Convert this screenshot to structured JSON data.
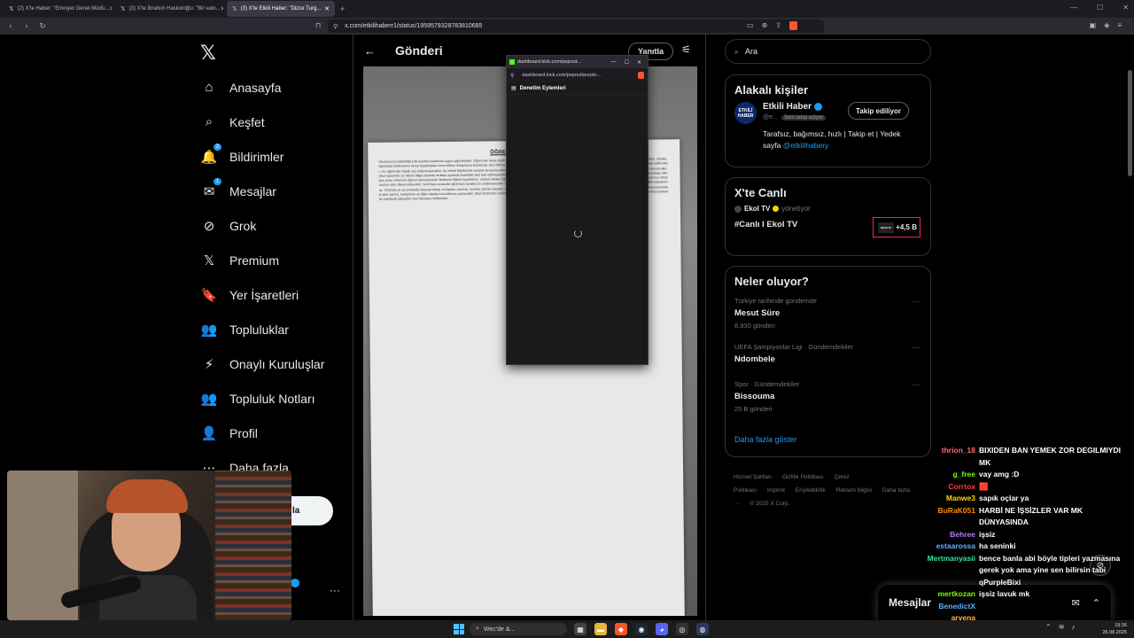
{
  "browser": {
    "tabs": [
      {
        "label": "(2) X'te Haber: \"Emniyet Genel Müdü...",
        "active": false
      },
      {
        "label": "(3) X'te İbrahim Haskoloğlu: \"Bir vatn...",
        "active": false
      },
      {
        "label": "(3) X'te Etkili Haber: \"Dizce Turg...",
        "active": true
      }
    ],
    "url": "x.com/etkilihaberr1/status/1959579328783810685"
  },
  "x": {
    "nav": [
      {
        "label": "Anasayfa",
        "icon": "home-icon",
        "glyph": "⌂",
        "badge": ""
      },
      {
        "label": "Keşfet",
        "icon": "search-icon",
        "glyph": "⌕",
        "badge": ""
      },
      {
        "label": "Bildirimler",
        "icon": "bell-icon",
        "glyph": "🔔",
        "badge": "3"
      },
      {
        "label": "Mesajlar",
        "icon": "mail-icon",
        "glyph": "✉",
        "badge": "1"
      },
      {
        "label": "Grok",
        "icon": "grok-icon",
        "glyph": "⊘",
        "badge": ""
      },
      {
        "label": "Premium",
        "icon": "x-premium-icon",
        "glyph": "𝕏",
        "badge": ""
      },
      {
        "label": "Yer İşaretleri",
        "icon": "bookmark-icon",
        "glyph": "🔖",
        "badge": ""
      },
      {
        "label": "Topluluklar",
        "icon": "communities-icon",
        "glyph": "👥",
        "badge": ""
      },
      {
        "label": "Onaylı Kuruluşlar",
        "icon": "lightning-icon",
        "glyph": "⚡",
        "badge": ""
      },
      {
        "label": "Topluluk Notları",
        "icon": "community-notes-icon",
        "glyph": "👥",
        "badge": ""
      },
      {
        "label": "Profil",
        "icon": "profile-icon",
        "glyph": "👤",
        "badge": ""
      },
      {
        "label": "Daha fazla",
        "icon": "more-icon",
        "glyph": "⋯",
        "badge": ""
      }
    ],
    "post_button_label": "la",
    "center": {
      "title": "Gönderi",
      "reply_label": "Yanıtla",
      "paper_title": "ÖĞRENCİLERİMİZİN DİKK",
      "paper_text": "Okulumuzun belirlediği kılık kıyafet kurallarına uygun giyinilecektir. Öğrenciler okula hiçbir şekilde hırka veya başka herhangi bir ekleme giyemeyecektir. Cep Telefonu kuralına uygun davranacaktır. Okulda, öğrenciler telefonlarını derse başlamadan önce telefon dolaplarına bırakacak, ders bitince alacaktır. Sınıf öğretmenleri bu konuda gerekli tedbirleri alacaktır. Saç, sakal ve makyaj konularına dikkat edilecektir. Kız öğrenciler boyalı saç kullanmayacaktır. Kız erkek ilişkilerinde seviyeli davranılacaktır. Sosyal Medya kullanımlarımıza azami derecede dikkat edilecektir. Kavga gürültü ortamlarından uzak durulacaktır. Okul idaresinin ve Velinin bilgisi dışında okuldan ayrılmak kesinlikle okul terk edilmeyecektir. Servis araçlarının iki tarafına da sebepsiz olarak biniliş biri öğrenci oturmayacaktır. Üst sınıflarda bulunduğu alanlara sınav ortamına öğrenci girmeyecektir. Bedenim Eğitimi kıyafetimiz, sadece Beden Eğitimi derslerinde giyilecektir. Ders Eğitimi dersinde streç-tayt-drop tarzı kıyafetler giyilmeyecektir. Kantinde kız erkek oturma alanı dikkat edilecektir. Sınıf ders sırasında öğrenciye tuvalet izni verilmeyecektir. Dersler akışını engellemek, amfin huzurunu bozmak, öğretmenlerin uyarılarını dikkate almamak kesinlikle karşılanmaz. Ortamda ya da sınıflarda bulunan dolap ve kapıları yazmak, üzerine çizmek yasaktır. Okul çevresinde kendi yetkinizi kullanmayınız, okul güvenliğine uymayan davranışlar sergilemeyiniz. Okul içerisindeki spor salonu, kütüphane ve diğer alanların kurallarına uyulacaktır. Okul tarafından verilen sınav ve dönem takvimine uyulacaktır. Velilerimiz iletişim için okul telefonunu kullanabilirler. Öğrenci velisi tarafından yapılacak şikayetler okul idaresine iletilecektir."
    },
    "popout": {
      "tab_title": "dashboard.kick.com/popout...",
      "url": "dashboard.kick.com/popout/purple...",
      "section_label": "Denetim Eylemleri"
    },
    "right": {
      "search_placeholder": "Ara",
      "related": {
        "title": "Alakalı kişiler",
        "name": "Etkili Haber",
        "handle": "@e...",
        "follows_you": "Seni takip ediyor",
        "follow_label": "Takip ediliyor",
        "avatar_text": "ETKİLİ HABER",
        "bio": "Tarafsız, bağımsız, hızlı | Takip et | Yedek sayfa",
        "bio_link": "@etkilihabery"
      },
      "live": {
        "title": "X'te Canlı",
        "host": "Ekol TV",
        "role": "yönetiyor",
        "stream_title": "#Canlı I Ekol TV",
        "thumb_text": "EKOLTV",
        "count": "+4,5 B"
      },
      "trends": {
        "title": "Neler oluyor?",
        "items": [
          {
            "context": "Türkiye tarihinde gündemde",
            "name": "Mesut Süre",
            "count": "8.930 gönderi"
          },
          {
            "context": "UEFA Şampiyonlar Ligi · Gündemdekiler",
            "name": "Ndombele",
            "count": ""
          },
          {
            "context": "Spor · Gündemdekiler",
            "name": "Bissouma",
            "count": "25 B gönderi"
          }
        ],
        "show_more": "Daha fazla göster"
      },
      "footer": [
        "Hizmet Şartları",
        "Gizlilik Politikası",
        "Çerez Politikası",
        "Imprint",
        "Erişilebilirlik",
        "Reklam bilgisi",
        "Daha fazla ···",
        "© 2025 X Corp."
      ]
    },
    "messages_drawer": {
      "title": "Mesajlar"
    }
  },
  "chat": [
    {
      "user": "thrion_18",
      "color": "#ff6b6b",
      "msg": "BIXIDEN BAN YEMEK ZOR DEGILMIYDI MK"
    },
    {
      "user": "g_free",
      "color": "#7CFC00",
      "msg": "vay amg :D"
    },
    {
      "user": "Corrtox",
      "color": "#ff3b3b",
      "msg": "🟥"
    },
    {
      "user": "Manwe3",
      "color": "#ffd700",
      "msg": "sapık oçlar ya"
    },
    {
      "user": "BuRaK051",
      "color": "#ff8c00",
      "msg": "HARBİ NE İŞSİZLER VAR MK DÜNYASINDA"
    },
    {
      "user": "Behree",
      "color": "#b57bff",
      "msg": "işsiz"
    },
    {
      "user": "estaarossa",
      "color": "#5ab0ff",
      "msg": "ha seninki"
    },
    {
      "user": "Mertmanyasii",
      "color": "#37e6a0",
      "msg": "bence banla abi böyle tipleri yazmasına gerek yok ama yine sen bilirsin tabi qPurpleBixi"
    },
    {
      "user": "mertkozan",
      "color": "#7CFC00",
      "msg": "işsiz lavuk mk"
    },
    {
      "user": "BenedictX",
      "color": "#5ab0ff",
      "msg": ""
    },
    {
      "user": "arvena",
      "color": "#ffb347",
      "msg": ""
    }
  ],
  "taskbar": {
    "search_label": "Wec'de &...",
    "time": "19:36",
    "date": "26.08.2025"
  },
  "colors": {
    "x_blue": "#1d9bf0",
    "live_pink": "#f91880",
    "kick_green": "#53fc18"
  }
}
